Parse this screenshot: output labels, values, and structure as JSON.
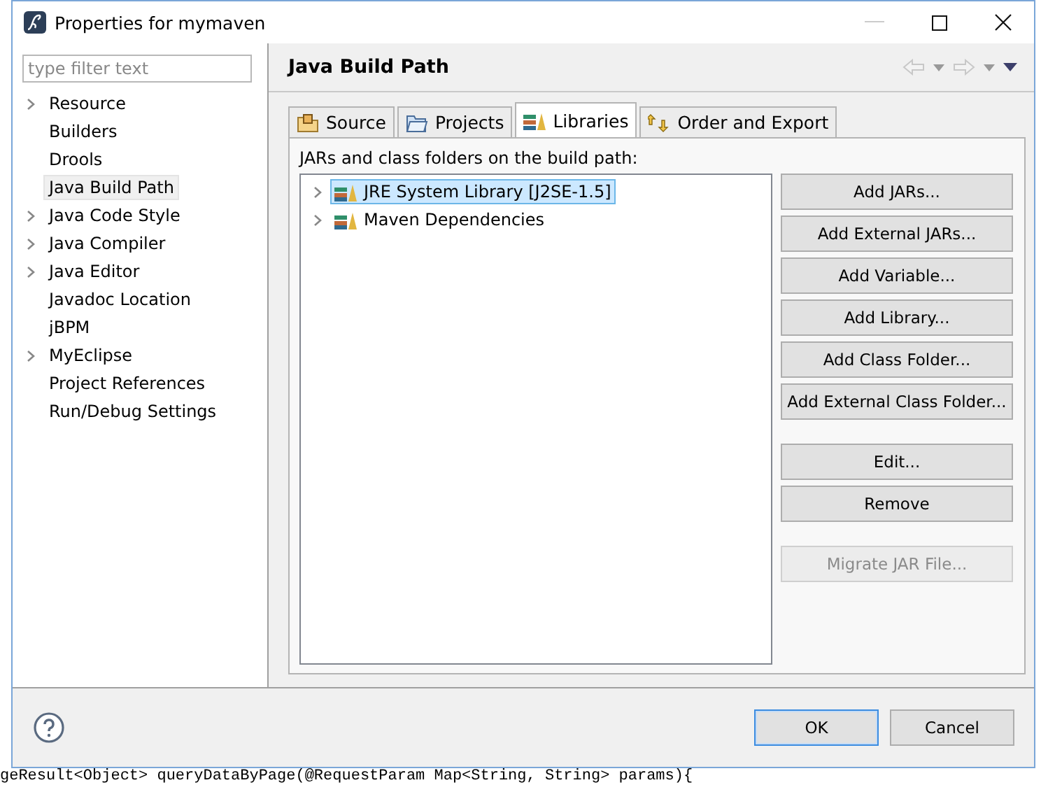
{
  "window": {
    "title": "Properties for mymaven"
  },
  "background_code": "geResult<Object> queryDataByPage(@RequestParam Map<String, String> params){",
  "sidebar": {
    "filter": {
      "placeholder": "type filter text"
    },
    "items": [
      {
        "label": "Resource",
        "expandable": true,
        "selected": false
      },
      {
        "label": "Builders",
        "expandable": false,
        "selected": false
      },
      {
        "label": "Drools",
        "expandable": false,
        "selected": false
      },
      {
        "label": "Java Build Path",
        "expandable": false,
        "selected": true
      },
      {
        "label": "Java Code Style",
        "expandable": true,
        "selected": false
      },
      {
        "label": "Java Compiler",
        "expandable": true,
        "selected": false
      },
      {
        "label": "Java Editor",
        "expandable": true,
        "selected": false
      },
      {
        "label": "Javadoc Location",
        "expandable": false,
        "selected": false
      },
      {
        "label": "jBPM",
        "expandable": false,
        "selected": false
      },
      {
        "label": "MyEclipse",
        "expandable": true,
        "selected": false
      },
      {
        "label": "Project References",
        "expandable": false,
        "selected": false
      },
      {
        "label": "Run/Debug Settings",
        "expandable": false,
        "selected": false
      }
    ]
  },
  "page": {
    "title": "Java Build Path",
    "tabs": [
      {
        "label": "Source",
        "kind": "source",
        "selected": false
      },
      {
        "label": "Projects",
        "kind": "projects",
        "selected": false
      },
      {
        "label": "Libraries",
        "kind": "libraries",
        "selected": true
      },
      {
        "label": "Order and Export",
        "kind": "order",
        "selected": false
      }
    ],
    "list_label": "JARs and class folders on the build path:",
    "entries": [
      {
        "label": "JRE System Library [J2SE-1.5]",
        "expanded": false,
        "selected": true
      },
      {
        "label": "Maven Dependencies",
        "expanded": false,
        "selected": false
      }
    ],
    "button_groups": [
      [
        {
          "label": "Add JARs...",
          "disabled": false
        },
        {
          "label": "Add External JARs...",
          "disabled": false
        },
        {
          "label": "Add Variable...",
          "disabled": false
        },
        {
          "label": "Add Library...",
          "disabled": false
        },
        {
          "label": "Add Class Folder...",
          "disabled": false
        },
        {
          "label": "Add External Class Folder...",
          "disabled": false
        }
      ],
      [
        {
          "label": "Edit...",
          "disabled": false
        },
        {
          "label": "Remove",
          "disabled": false
        }
      ],
      [
        {
          "label": "Migrate JAR File...",
          "disabled": true
        }
      ]
    ]
  },
  "footer_buttons": [
    {
      "label": "OK",
      "default": true
    },
    {
      "label": "Cancel",
      "default": false
    }
  ]
}
